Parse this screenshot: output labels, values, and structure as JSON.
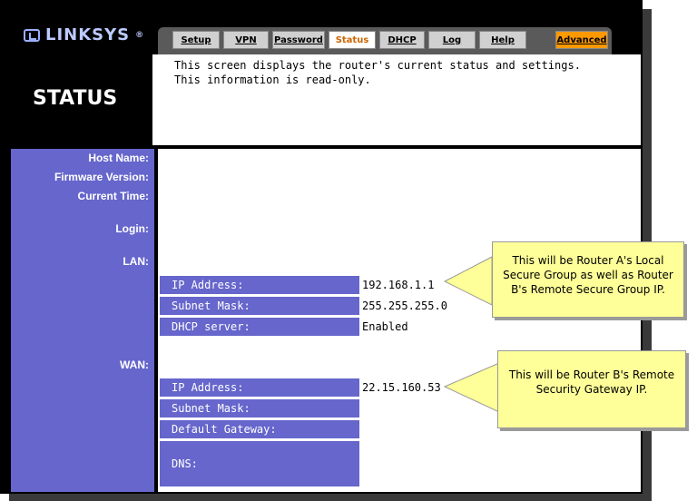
{
  "brand": {
    "logo": "LINKSYS",
    "reg": "®"
  },
  "tabs": [
    {
      "label": "Setup"
    },
    {
      "label": "VPN"
    },
    {
      "label": "Password"
    },
    {
      "label": "Status"
    },
    {
      "label": "DHCP"
    },
    {
      "label": "Log"
    },
    {
      "label": "Help"
    },
    {
      "label": "Advanced"
    }
  ],
  "page": {
    "title": "STATUS",
    "description": "This screen displays the router's current status and settings. This information is read-only."
  },
  "labels": {
    "host_name": "Host Name:",
    "firmware": "Firmware Version:",
    "current_time": "Current Time:",
    "login": "Login:",
    "lan": "LAN:",
    "wan": "WAN:"
  },
  "lan": {
    "ip_label": "IP Address:",
    "ip_value": "192.168.1.1",
    "mask_label": "Subnet Mask:",
    "mask_value": "255.255.255.0",
    "dhcp_label": "DHCP server:",
    "dhcp_value": "Enabled"
  },
  "wan": {
    "ip_label": "IP Address:",
    "ip_value": "22.15.160.53",
    "mask_label": "Subnet Mask:",
    "gw_label": "Default Gateway:",
    "dns_label": "DNS:"
  },
  "callouts": {
    "lan": "This will be Router A's Local Secure Group as well as Router B's Remote Secure Group IP.",
    "wan": "This will be Router B's Remote Security Gateway IP."
  }
}
